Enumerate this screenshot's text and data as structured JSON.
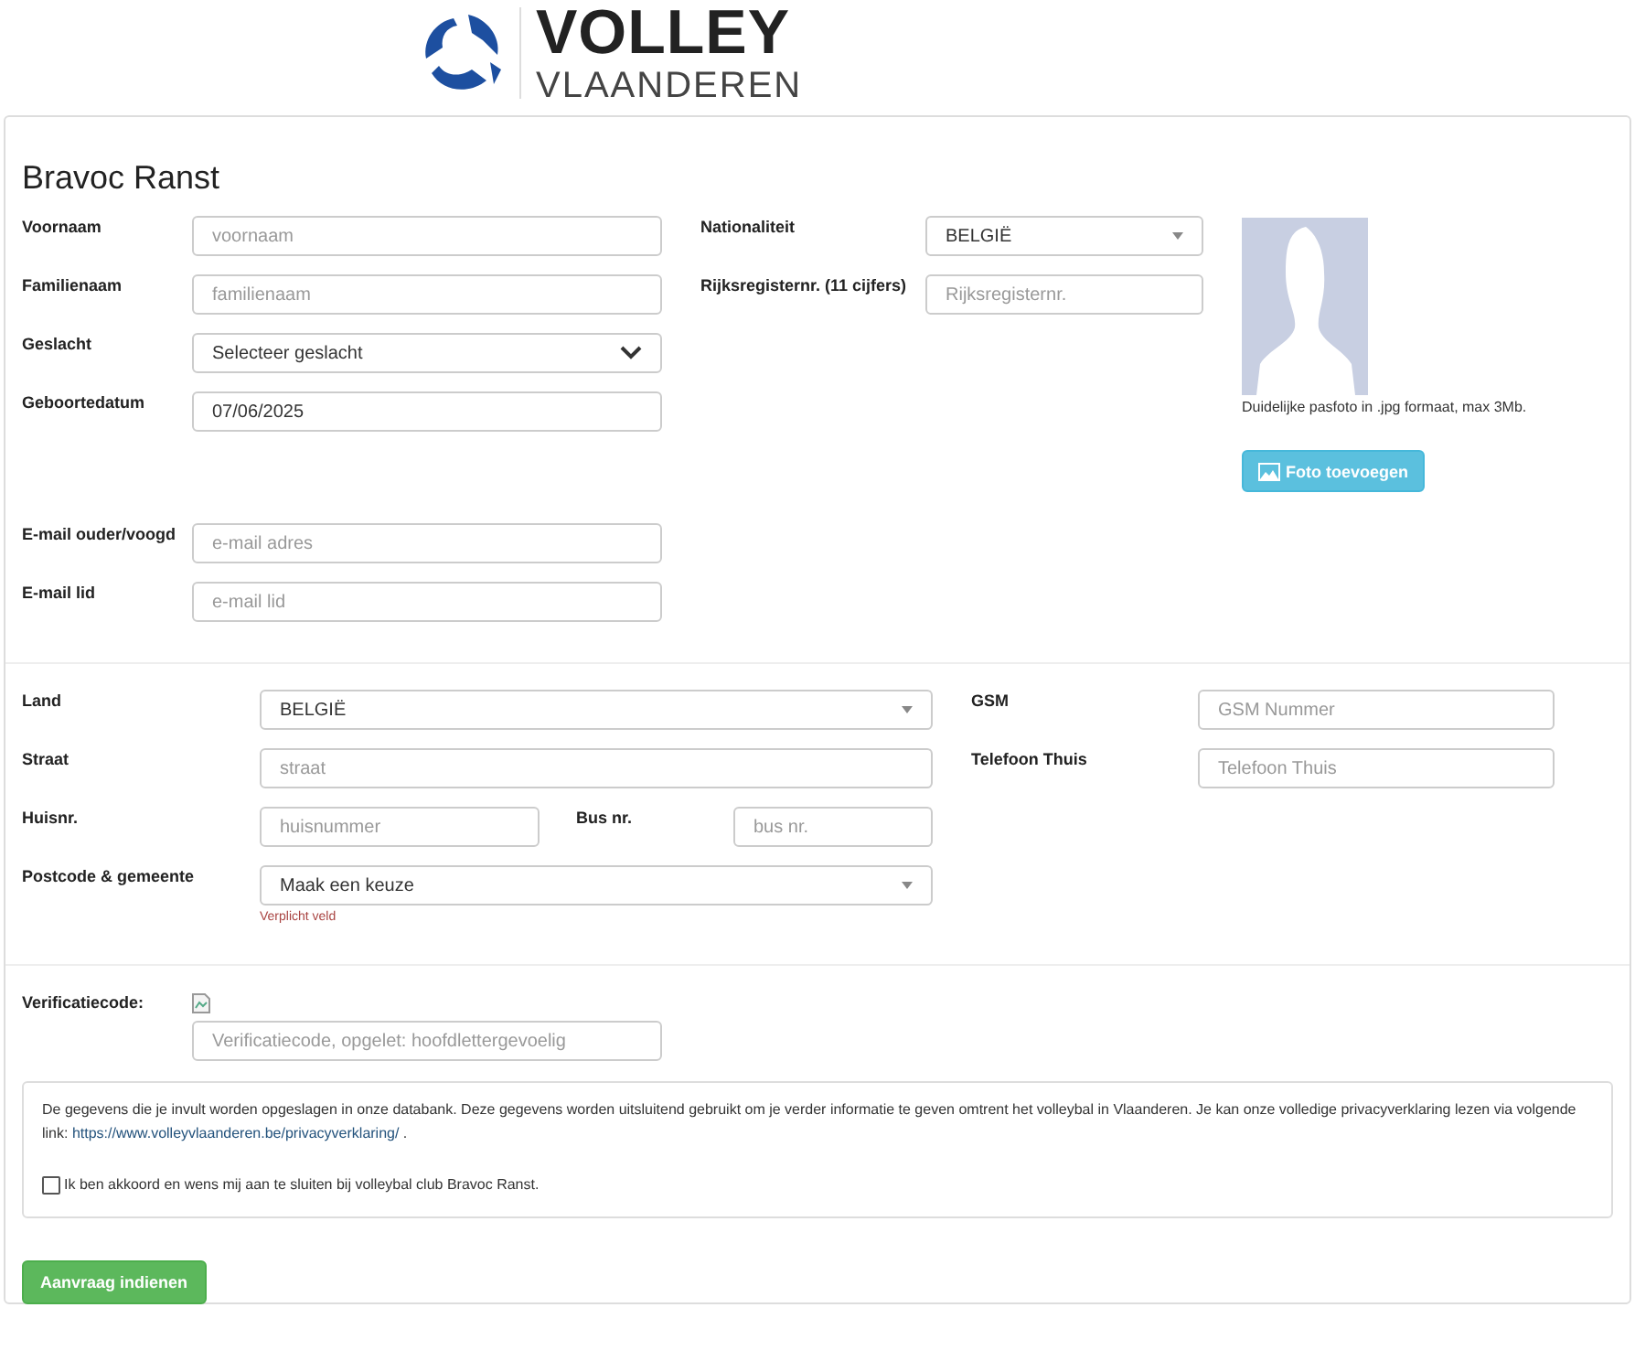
{
  "logo": {
    "wordmark": "VOLLEY",
    "subtitle": "VLAANDEREN"
  },
  "title": "Bravoc Ranst",
  "personal": {
    "fields": [
      {
        "label": "Voornaam",
        "kind": "text",
        "placeholder": "voornaam"
      },
      {
        "label": "Familienaam",
        "kind": "text",
        "placeholder": "familienaam"
      },
      {
        "label": "Geslacht",
        "kind": "select",
        "value": "Selecteer geslacht"
      },
      {
        "label": "Geboortedatum",
        "kind": "text",
        "value": "07/06/2025"
      }
    ],
    "emails": [
      {
        "label": "E-mail ouder/voogd",
        "kind": "text",
        "placeholder": "e-mail adres"
      },
      {
        "label": "E-mail lid",
        "kind": "text",
        "placeholder": "e-mail lid"
      }
    ],
    "identity": [
      {
        "label": "Nationaliteit",
        "kind": "combo",
        "value": "BELGIË"
      },
      {
        "label": "Rijksregisternr. (11 cijfers)",
        "kind": "text",
        "placeholder": "Rijksregisternr."
      }
    ]
  },
  "photo": {
    "caption": "Duidelijke pasfoto in .jpg formaat, max 3Mb.",
    "button": "Foto toevoegen"
  },
  "address": {
    "land": {
      "label": "Land",
      "kind": "combo",
      "value": "BELGIË"
    },
    "straat": {
      "label": "Straat",
      "kind": "text",
      "placeholder": "straat"
    },
    "huisnr": {
      "label": "Huisnr.",
      "kind": "text",
      "placeholder": "huisnummer"
    },
    "bus": {
      "label": "Bus nr.",
      "kind": "text",
      "placeholder": "bus nr."
    },
    "postcode": {
      "label": "Postcode & gemeente",
      "kind": "combo",
      "value": "Maak een keuze",
      "error": "Verplicht veld"
    },
    "phones": [
      {
        "label": "GSM",
        "kind": "text",
        "placeholder": "GSM Nummer"
      },
      {
        "label": "Telefoon Thuis",
        "kind": "text",
        "placeholder": "Telefoon Thuis"
      }
    ]
  },
  "verification": {
    "label": "Verificatiecode:",
    "kind": "text",
    "placeholder": "Verificatiecode, opgelet: hoofdlettergevoelig"
  },
  "privacy": {
    "text": "De gegevens die je invult worden opgeslagen in onze databank. Deze gegevens worden uitsluitend gebruikt om je verder informatie te geven omtrent het volleybal in Vlaanderen. Je kan onze volledige privacyverklaring lezen via volgende link:",
    "link": "https://www.volleyvlaanderen.be/privacyverklaring/",
    "after": ".",
    "agreement": {
      "label": "Ik ben akkoord en wens mij aan te sluiten bij volleybal club Bravoc Ranst.",
      "checked": false
    }
  },
  "submit": "Aanvraag indienen"
}
